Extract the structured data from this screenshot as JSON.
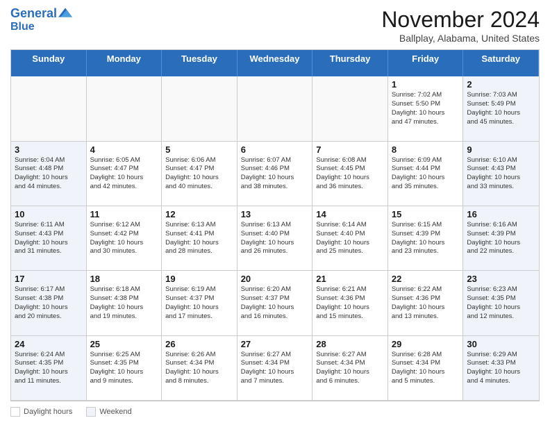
{
  "header": {
    "logo_line1": "General",
    "logo_line2": "Blue",
    "month_title": "November 2024",
    "location": "Ballplay, Alabama, United States"
  },
  "footer": {
    "daylight_hours_label": "Daylight hours",
    "weekend_label": "Weekend"
  },
  "days_of_week": [
    "Sunday",
    "Monday",
    "Tuesday",
    "Wednesday",
    "Thursday",
    "Friday",
    "Saturday"
  ],
  "weeks": [
    [
      {
        "date": "",
        "info": ""
      },
      {
        "date": "",
        "info": ""
      },
      {
        "date": "",
        "info": ""
      },
      {
        "date": "",
        "info": ""
      },
      {
        "date": "",
        "info": ""
      },
      {
        "date": "1",
        "info": "Sunrise: 7:02 AM\nSunset: 5:50 PM\nDaylight: 10 hours\nand 47 minutes."
      },
      {
        "date": "2",
        "info": "Sunrise: 7:03 AM\nSunset: 5:49 PM\nDaylight: 10 hours\nand 45 minutes."
      }
    ],
    [
      {
        "date": "3",
        "info": "Sunrise: 6:04 AM\nSunset: 4:48 PM\nDaylight: 10 hours\nand 44 minutes."
      },
      {
        "date": "4",
        "info": "Sunrise: 6:05 AM\nSunset: 4:47 PM\nDaylight: 10 hours\nand 42 minutes."
      },
      {
        "date": "5",
        "info": "Sunrise: 6:06 AM\nSunset: 4:47 PM\nDaylight: 10 hours\nand 40 minutes."
      },
      {
        "date": "6",
        "info": "Sunrise: 6:07 AM\nSunset: 4:46 PM\nDaylight: 10 hours\nand 38 minutes."
      },
      {
        "date": "7",
        "info": "Sunrise: 6:08 AM\nSunset: 4:45 PM\nDaylight: 10 hours\nand 36 minutes."
      },
      {
        "date": "8",
        "info": "Sunrise: 6:09 AM\nSunset: 4:44 PM\nDaylight: 10 hours\nand 35 minutes."
      },
      {
        "date": "9",
        "info": "Sunrise: 6:10 AM\nSunset: 4:43 PM\nDaylight: 10 hours\nand 33 minutes."
      }
    ],
    [
      {
        "date": "10",
        "info": "Sunrise: 6:11 AM\nSunset: 4:43 PM\nDaylight: 10 hours\nand 31 minutes."
      },
      {
        "date": "11",
        "info": "Sunrise: 6:12 AM\nSunset: 4:42 PM\nDaylight: 10 hours\nand 30 minutes."
      },
      {
        "date": "12",
        "info": "Sunrise: 6:13 AM\nSunset: 4:41 PM\nDaylight: 10 hours\nand 28 minutes."
      },
      {
        "date": "13",
        "info": "Sunrise: 6:13 AM\nSunset: 4:40 PM\nDaylight: 10 hours\nand 26 minutes."
      },
      {
        "date": "14",
        "info": "Sunrise: 6:14 AM\nSunset: 4:40 PM\nDaylight: 10 hours\nand 25 minutes."
      },
      {
        "date": "15",
        "info": "Sunrise: 6:15 AM\nSunset: 4:39 PM\nDaylight: 10 hours\nand 23 minutes."
      },
      {
        "date": "16",
        "info": "Sunrise: 6:16 AM\nSunset: 4:39 PM\nDaylight: 10 hours\nand 22 minutes."
      }
    ],
    [
      {
        "date": "17",
        "info": "Sunrise: 6:17 AM\nSunset: 4:38 PM\nDaylight: 10 hours\nand 20 minutes."
      },
      {
        "date": "18",
        "info": "Sunrise: 6:18 AM\nSunset: 4:38 PM\nDaylight: 10 hours\nand 19 minutes."
      },
      {
        "date": "19",
        "info": "Sunrise: 6:19 AM\nSunset: 4:37 PM\nDaylight: 10 hours\nand 17 minutes."
      },
      {
        "date": "20",
        "info": "Sunrise: 6:20 AM\nSunset: 4:37 PM\nDaylight: 10 hours\nand 16 minutes."
      },
      {
        "date": "21",
        "info": "Sunrise: 6:21 AM\nSunset: 4:36 PM\nDaylight: 10 hours\nand 15 minutes."
      },
      {
        "date": "22",
        "info": "Sunrise: 6:22 AM\nSunset: 4:36 PM\nDaylight: 10 hours\nand 13 minutes."
      },
      {
        "date": "23",
        "info": "Sunrise: 6:23 AM\nSunset: 4:35 PM\nDaylight: 10 hours\nand 12 minutes."
      }
    ],
    [
      {
        "date": "24",
        "info": "Sunrise: 6:24 AM\nSunset: 4:35 PM\nDaylight: 10 hours\nand 11 minutes."
      },
      {
        "date": "25",
        "info": "Sunrise: 6:25 AM\nSunset: 4:35 PM\nDaylight: 10 hours\nand 9 minutes."
      },
      {
        "date": "26",
        "info": "Sunrise: 6:26 AM\nSunset: 4:34 PM\nDaylight: 10 hours\nand 8 minutes."
      },
      {
        "date": "27",
        "info": "Sunrise: 6:27 AM\nSunset: 4:34 PM\nDaylight: 10 hours\nand 7 minutes."
      },
      {
        "date": "28",
        "info": "Sunrise: 6:27 AM\nSunset: 4:34 PM\nDaylight: 10 hours\nand 6 minutes."
      },
      {
        "date": "29",
        "info": "Sunrise: 6:28 AM\nSunset: 4:34 PM\nDaylight: 10 hours\nand 5 minutes."
      },
      {
        "date": "30",
        "info": "Sunrise: 6:29 AM\nSunset: 4:33 PM\nDaylight: 10 hours\nand 4 minutes."
      }
    ]
  ]
}
